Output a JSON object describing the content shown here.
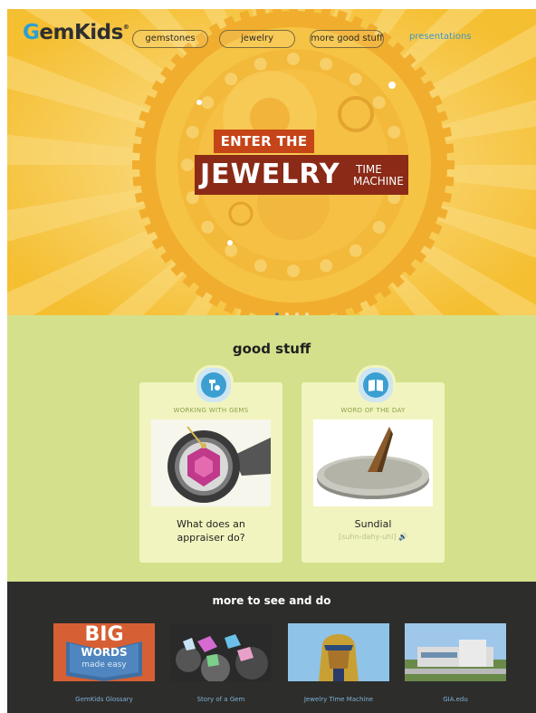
{
  "header": {
    "logo": "GemKids",
    "logo_mark": "®",
    "nav": [
      {
        "label": "gemstones"
      },
      {
        "label": "jewelry"
      },
      {
        "label": "more good stuff"
      }
    ],
    "link": "presentations"
  },
  "hero": {
    "line1": "ENTER THE",
    "line2": "JEWELRY",
    "line3a": "TIME",
    "line3b": "MACHINE",
    "slide_count": 4,
    "active_slide": 1
  },
  "good_stuff": {
    "title": "good stuff",
    "cards": [
      {
        "icon": "gem-tools-icon",
        "caption": "WORKING WITH GEMS",
        "text_line1": "What does an",
        "text_line2": "appraiser do?"
      },
      {
        "icon": "book-icon",
        "caption": "WORD OF THE DAY",
        "text_line1": "Sundial",
        "pronunciation": "[suhn-dahy-uhl]"
      }
    ]
  },
  "more": {
    "title": "more to see and do",
    "items": [
      {
        "caption": "GemKids Glossary",
        "big": "BIG",
        "words": "WORDS",
        "made": "made easy"
      },
      {
        "caption": "Story of a Gem"
      },
      {
        "caption": "Jewelry Time Machine"
      },
      {
        "caption": "GIA.edu"
      }
    ]
  },
  "colors": {
    "accent_blue": "#3b9fd2",
    "hero_yellow": "#f7c842",
    "good_green": "#d4e08c",
    "footer_dark": "#2d2d2c"
  }
}
